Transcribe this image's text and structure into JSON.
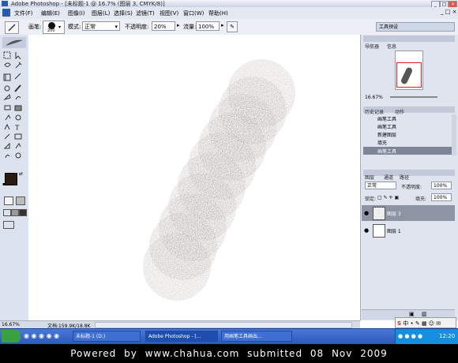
{
  "window": {
    "title": "Adobe Photoshop - [未标题-1 @ 16.7% (图层 3, CMYK/8)]",
    "controls": [
      "_",
      "□",
      "×"
    ]
  },
  "menu": [
    "文件(F)",
    "编辑(E)",
    "图像(I)",
    "图层(L)",
    "选择(S)",
    "滤镜(T)",
    "视图(V)",
    "窗口(W)",
    "帮助(H)"
  ],
  "options": {
    "brush_label": "画笔:",
    "brush_size": "200",
    "mode_label": "模式:",
    "mode_value": "正常",
    "opacity_label": "不透明度:",
    "opacity_value": "20%",
    "flow_label": "流量:",
    "flow_value": "100%",
    "palette_well": "工具预设"
  },
  "status": {
    "zoom": "16.67%",
    "doc": "文档:159.9K/18.8K"
  },
  "navigator": {
    "tabs": [
      "导航器",
      "信息"
    ],
    "zoom": "16.67%"
  },
  "history": {
    "tabs": [
      "历史记录",
      "动作"
    ],
    "items": [
      "画笔工具",
      "画笔工具",
      "新建图层",
      "填充",
      "画笔工具"
    ]
  },
  "layers": {
    "tabs": [
      "图层",
      "通道",
      "路径"
    ],
    "blend_mode": "正常",
    "opacity_label": "不透明度:",
    "opacity_value": "100%",
    "lock_label": "锁定:",
    "fill_label": "填充:",
    "fill_value": "100%",
    "items": [
      {
        "name": "图层 3",
        "selected": true
      },
      {
        "name": "图层 1",
        "selected": false
      }
    ]
  },
  "taskbar": {
    "tasks": [
      "未标题-1 (D:)",
      "Adobe Photoshop - [...",
      "用画笔工具画出..."
    ],
    "tray_time": "12:20"
  },
  "footer": "Powered by www.chahua.com submitted 08 Nov 2009",
  "colors": {
    "foreground": "#2a1a12",
    "background": "#ffffff",
    "stroke": "#6b5e52"
  }
}
